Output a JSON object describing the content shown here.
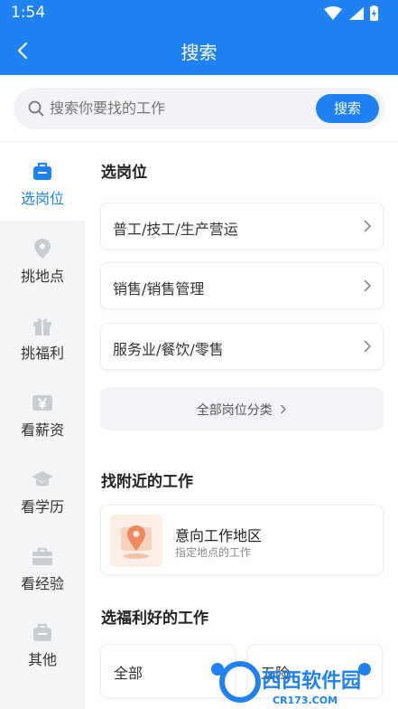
{
  "status_bar": {
    "time": "1:54"
  },
  "header": {
    "title": "搜索"
  },
  "search": {
    "placeholder": "搜索你要找的工作",
    "button_label": "搜索"
  },
  "sidebar": {
    "items": [
      {
        "label": "选岗位",
        "active": true
      },
      {
        "label": "挑地点",
        "active": false
      },
      {
        "label": "挑福利",
        "active": false
      },
      {
        "label": "看薪资",
        "active": false
      },
      {
        "label": "看学历",
        "active": false
      },
      {
        "label": "看经验",
        "active": false
      },
      {
        "label": "其他",
        "active": false
      }
    ]
  },
  "main": {
    "section_jobs": {
      "title": "选岗位",
      "categories": [
        "普工/技工/生产营运",
        "销售/销售管理",
        "服务业/餐饮/零售"
      ],
      "all_label": "全部岗位分类"
    },
    "section_nearby": {
      "title": "找附近的工作",
      "card_title": "意向工作地区",
      "card_sub": "指定地点的工作"
    },
    "section_benefits": {
      "title": "选福利好的工作",
      "items": [
        "全部",
        "五险"
      ]
    }
  },
  "watermark": {
    "text": "西西软件园",
    "url_text": "CR173.COM"
  },
  "colors": {
    "primary": "#1F82F2",
    "sidebar_bg": "#F4F5F7",
    "search_bg": "#F2F3F6"
  }
}
